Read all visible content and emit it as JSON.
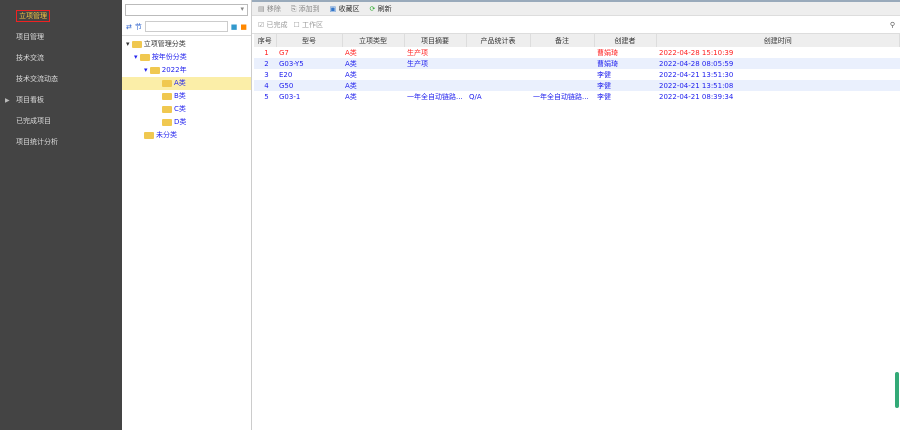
{
  "sidebar": {
    "items": [
      {
        "label": "立项管理",
        "active": true
      },
      {
        "label": "项目管理"
      },
      {
        "label": "技术交流"
      },
      {
        "label": "技术交流动态"
      },
      {
        "label": "项目看板",
        "expandable": true
      },
      {
        "label": "已完成项目"
      },
      {
        "label": "项目统计分析"
      }
    ]
  },
  "tree": {
    "toolbar_label": "节",
    "nodes": [
      {
        "label": "立项管理分类",
        "level": 0
      },
      {
        "label": "按年份分类",
        "level": 1
      },
      {
        "label": "2022年",
        "level": 2
      },
      {
        "label": "A类",
        "level": 3,
        "selected": true
      },
      {
        "label": "B类",
        "level": 3
      },
      {
        "label": "C类",
        "level": 3
      },
      {
        "label": "D类",
        "level": 3
      },
      {
        "label": "未分类",
        "level": 1
      }
    ]
  },
  "toolbar": {
    "remove": "移除",
    "add_to": "添加到",
    "favorites": "收藏区",
    "refresh": "刷新"
  },
  "filters": {
    "completed": "已完成",
    "workspace": "工作区"
  },
  "table": {
    "columns": [
      "序号",
      "型号",
      "立项类型",
      "项目摘要",
      "产品统计表",
      "备注",
      "创建者",
      "创建时间"
    ],
    "rows": [
      [
        "1",
        "G7",
        "A类",
        "生产项",
        "",
        "",
        "曹娟琦",
        "2022-04-28 15:10:39"
      ],
      [
        "2",
        "G03-Y5",
        "A类",
        "生产项",
        "",
        "",
        "曹娟琦",
        "2022-04-28 08:05:59"
      ],
      [
        "3",
        "E20",
        "A类",
        "",
        "",
        "",
        "李健",
        "2022-04-21 13:51:30"
      ],
      [
        "4",
        "G50",
        "A类",
        "",
        "",
        "",
        "李健",
        "2022-04-21 13:51:08"
      ],
      [
        "5",
        "G03-1",
        "A类",
        "一年全自动链路...",
        "Q/A",
        "一年全自动链路...",
        "李健",
        "2022-04-21 08:39:34"
      ]
    ]
  }
}
